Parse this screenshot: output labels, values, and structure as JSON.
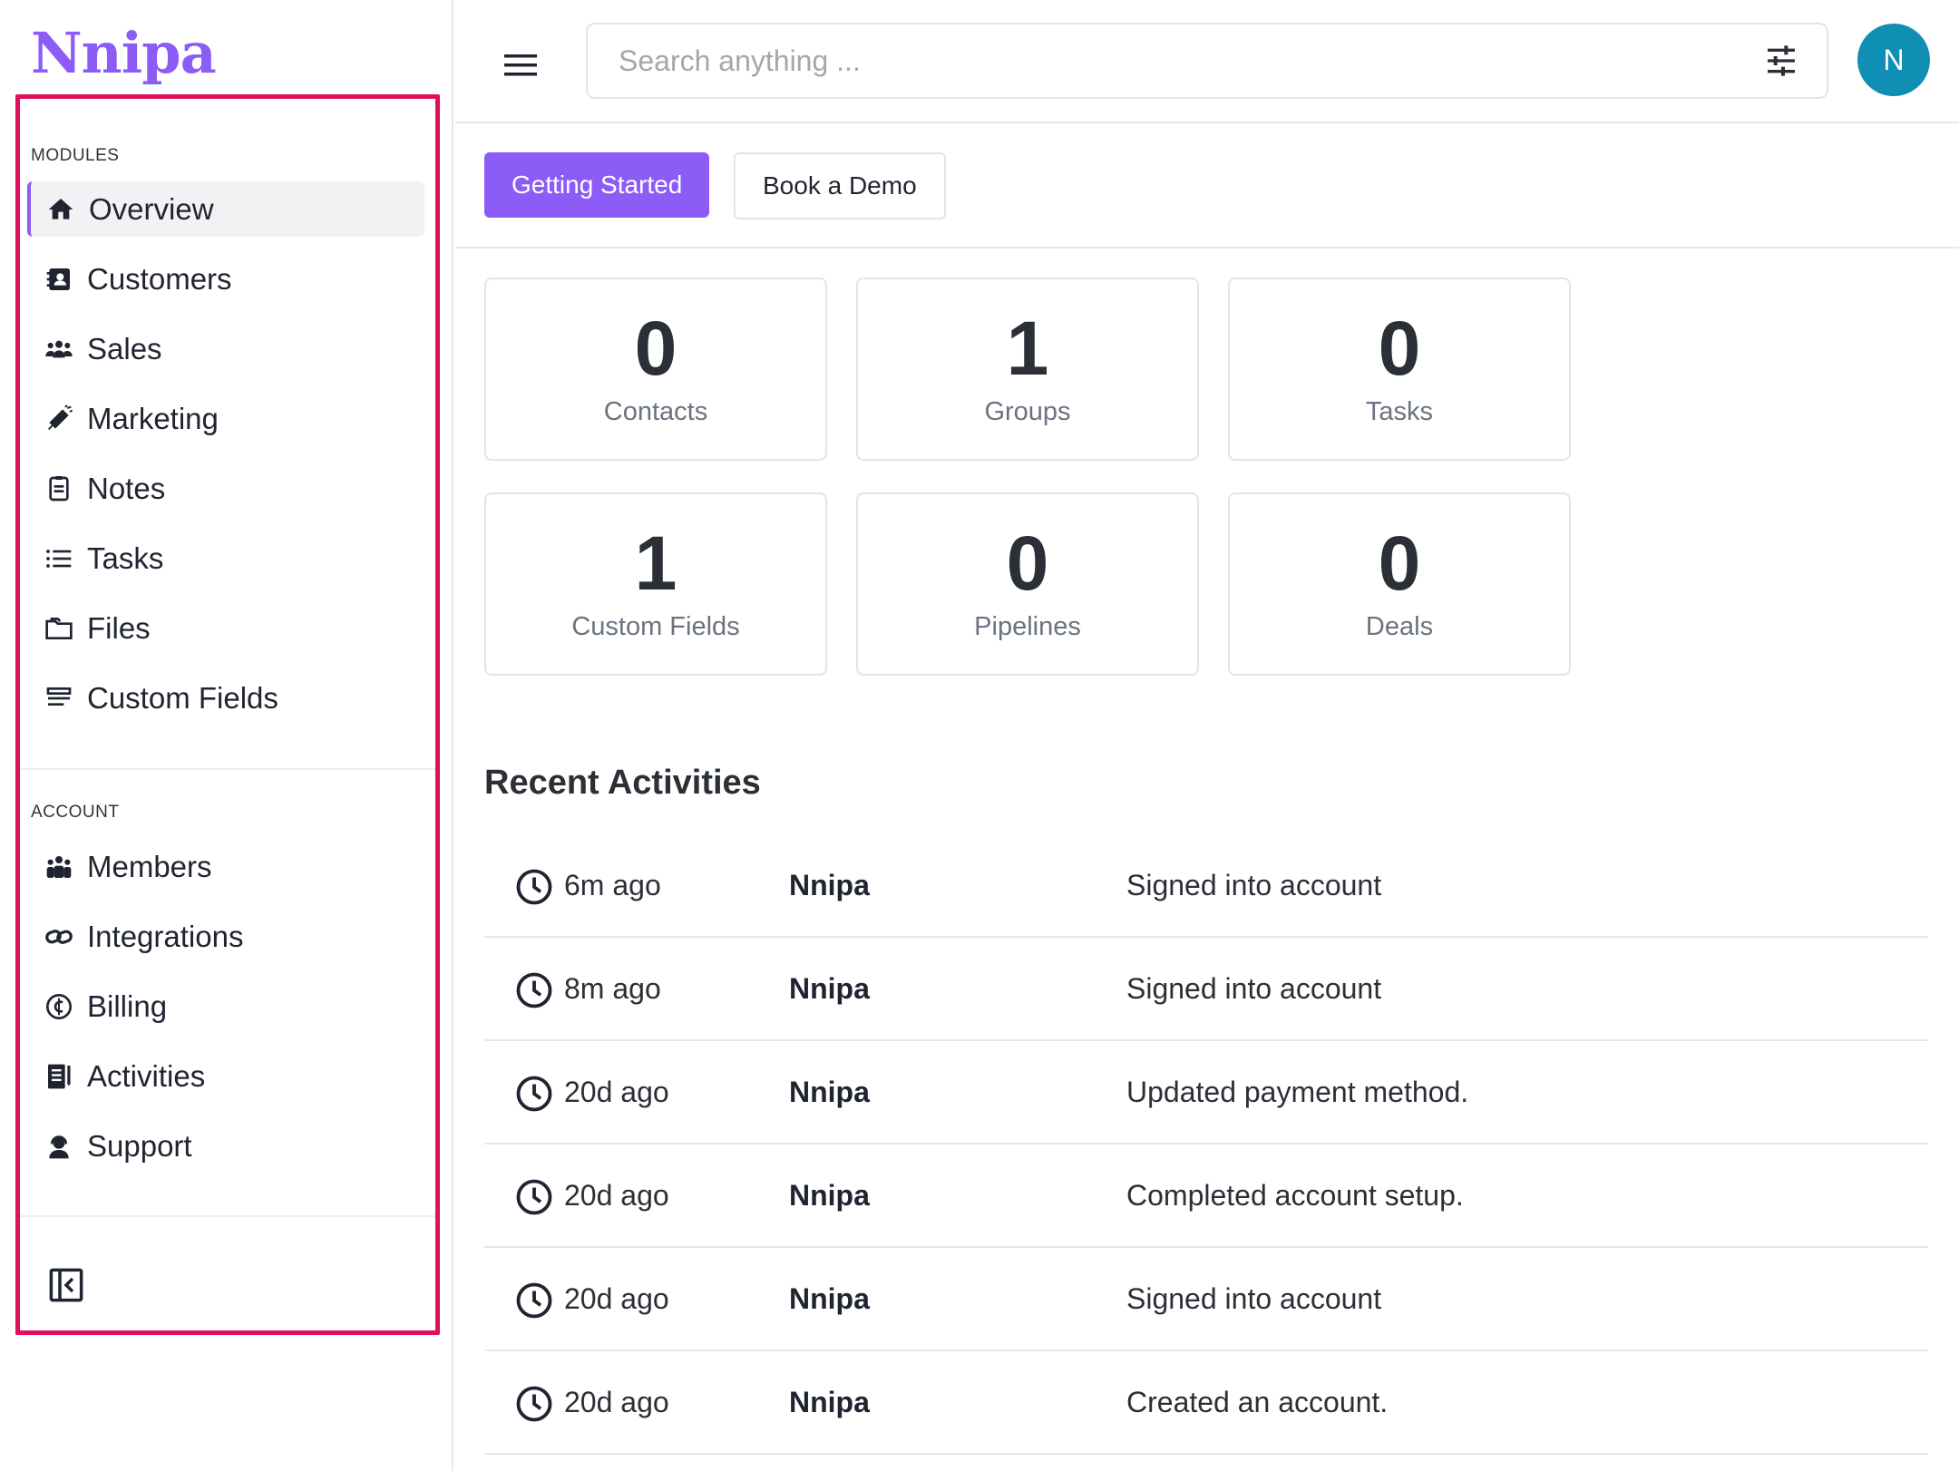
{
  "brand": {
    "name": "Nnipa",
    "color": "#8b5cf6"
  },
  "sidebar": {
    "modules_label": "MODULES",
    "modules": [
      {
        "label": "Overview",
        "icon": "home-icon",
        "active": true
      },
      {
        "label": "Customers",
        "icon": "contacts-icon"
      },
      {
        "label": "Sales",
        "icon": "users-group-icon"
      },
      {
        "label": "Marketing",
        "icon": "megaphone-icon"
      },
      {
        "label": "Notes",
        "icon": "notes-icon"
      },
      {
        "label": "Tasks",
        "icon": "list-icon"
      },
      {
        "label": "Files",
        "icon": "folder-icon"
      },
      {
        "label": "Custom Fields",
        "icon": "fields-icon"
      }
    ],
    "account_label": "ACCOUNT",
    "account": [
      {
        "label": "Members",
        "icon": "members-icon"
      },
      {
        "label": "Integrations",
        "icon": "link-icon"
      },
      {
        "label": "Billing",
        "icon": "currency-icon"
      },
      {
        "label": "Activities",
        "icon": "activities-icon"
      },
      {
        "label": "Support",
        "icon": "support-icon"
      }
    ],
    "collapse_icon": "sidebar-collapse-icon",
    "highlight_color": "#e0105f"
  },
  "topbar": {
    "search_placeholder": "Search anything ...",
    "avatar_initial": "N",
    "avatar_color": "#0f8fb4"
  },
  "actions": {
    "getting_started": "Getting Started",
    "book_demo": "Book a Demo"
  },
  "stats": [
    {
      "value": "0",
      "label": "Contacts"
    },
    {
      "value": "1",
      "label": "Groups"
    },
    {
      "value": "0",
      "label": "Tasks"
    },
    {
      "value": "1",
      "label": "Custom Fields"
    },
    {
      "value": "0",
      "label": "Pipelines"
    },
    {
      "value": "0",
      "label": "Deals"
    }
  ],
  "activities": {
    "title": "Recent Activities",
    "rows": [
      {
        "time": "6m ago",
        "user": "Nnipa",
        "description": "Signed into account"
      },
      {
        "time": "8m ago",
        "user": "Nnipa",
        "description": "Signed into account"
      },
      {
        "time": "20d ago",
        "user": "Nnipa",
        "description": "Updated payment method."
      },
      {
        "time": "20d ago",
        "user": "Nnipa",
        "description": "Completed account setup."
      },
      {
        "time": "20d ago",
        "user": "Nnipa",
        "description": "Signed into account"
      },
      {
        "time": "20d ago",
        "user": "Nnipa",
        "description": "Created an account."
      }
    ]
  }
}
